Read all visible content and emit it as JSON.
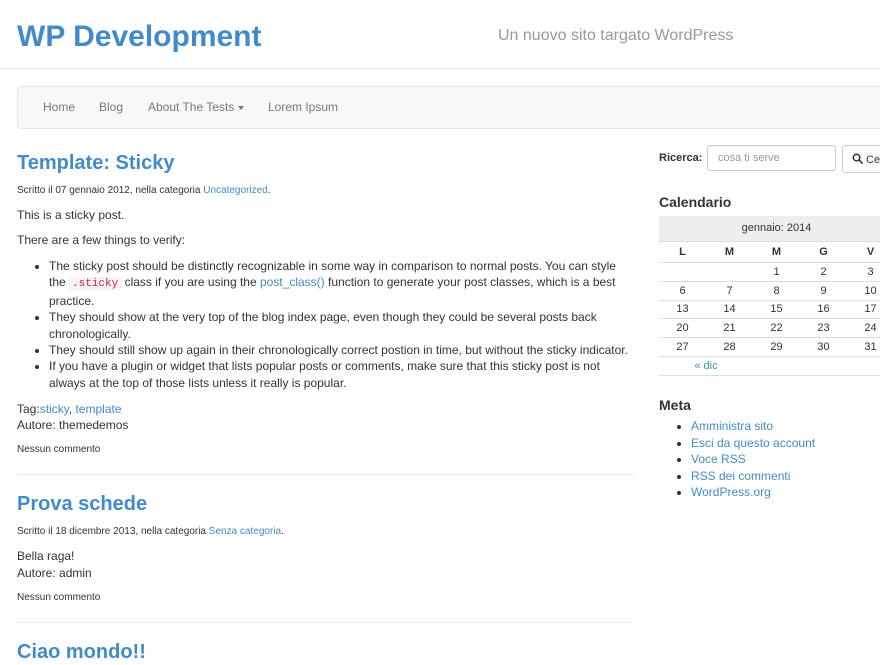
{
  "site": {
    "title": "WP Development",
    "description": "Un nuovo sito targato WordPress"
  },
  "nav": {
    "items": [
      {
        "label": "Home"
      },
      {
        "label": "Blog"
      },
      {
        "label": "About The Tests"
      },
      {
        "label": "Lorem Ipsum"
      }
    ]
  },
  "posts": [
    {
      "title": "Template: Sticky",
      "meta_prefix": "Scritto il 07 gennaio 2012, nella categoria ",
      "category": "Uncategorized",
      "meta_suffix": ".",
      "p1": "This is a sticky post.",
      "p2": "There are a few things to verify:",
      "bullets": {
        "b1_pre": "The sticky post should be distinctly recognizable in some way in comparison to normal posts. You can style the ",
        "b1_code": ".sticky",
        "b1_mid": " class if you are using the ",
        "b1_link": "post_class()",
        "b1_post": " function to generate your post classes, which is a best practice.",
        "b2": "They should show at the very top of the blog index page, even though they could be several posts back chronologically.",
        "b3": "They should still show up again in their chronologically correct postion in time, but without the sticky indicator.",
        "b4": "If you have a plugin or widget that lists popular posts or comments, make sure that this sticky post is not always at the top of those lists unless it really is popular."
      },
      "tags_label": "Tag:",
      "tag1": "sticky",
      "tag_sep": ", ",
      "tag2": "template",
      "author": "Autore: themedemos",
      "comments": "Nessun commento"
    },
    {
      "title": "Prova schede",
      "meta_prefix": "Scritto il 18 dicembre 2013, nella categoria ",
      "category": "Senza categoria",
      "meta_suffix": ".",
      "body": "Bella raga!",
      "author": "Autore: admin",
      "comments": "Nessun commento"
    },
    {
      "title": "Ciao mondo!!"
    }
  ],
  "sidebar": {
    "search": {
      "label": "Ricerca:",
      "placeholder": "cosa ti serve",
      "button": "Cerca"
    },
    "calendar": {
      "title": "Calendario",
      "caption": "gennaio: 2014",
      "days": [
        "L",
        "M",
        "M",
        "G",
        "V"
      ],
      "weeks": [
        [
          "",
          "",
          "1",
          "2",
          "3"
        ],
        [
          "6",
          "7",
          "8",
          "9",
          "10"
        ],
        [
          "13",
          "14",
          "15",
          "16",
          "17"
        ],
        [
          "20",
          "21",
          "22",
          "23",
          "24"
        ],
        [
          "27",
          "28",
          "29",
          "30",
          "31"
        ]
      ],
      "prev": "« dic"
    },
    "meta": {
      "title": "Meta",
      "links": [
        {
          "label": "Amministra sito"
        },
        {
          "label": "Esci da questo account"
        },
        {
          "label": "Voce RSS"
        },
        {
          "label": "RSS dei commenti"
        },
        {
          "label": "WordPress.org"
        }
      ]
    }
  },
  "colors": {
    "accent": "#428bca",
    "muted": "#999999"
  }
}
